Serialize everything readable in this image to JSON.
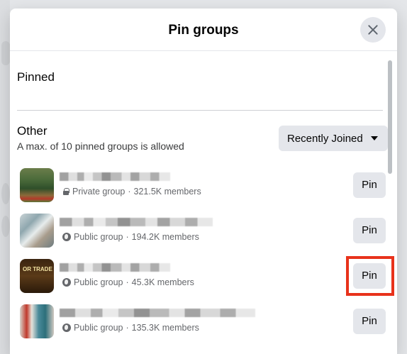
{
  "dialog": {
    "title": "Pin groups",
    "close_icon": "close-icon"
  },
  "sections": {
    "pinned_label": "Pinned",
    "other_label": "Other",
    "other_hint": "A max. of 10 pinned groups is allowed"
  },
  "sort": {
    "selected": "Recently Joined",
    "icon": "caret-down-icon"
  },
  "groups": [
    {
      "privacy": "Private group",
      "members": "321.5K members",
      "privacy_icon": "lock-icon",
      "pin_label": "Pin",
      "highlighted": false
    },
    {
      "privacy": "Public group",
      "members": "194.2K members",
      "privacy_icon": "globe-icon",
      "pin_label": "Pin",
      "highlighted": false
    },
    {
      "privacy": "Public group",
      "members": "45.3K members",
      "privacy_icon": "globe-icon",
      "pin_label": "Pin",
      "highlighted": true,
      "thumb_text": "OR TRADE"
    },
    {
      "privacy": "Public group",
      "members": "135.3K members",
      "privacy_icon": "globe-icon",
      "pin_label": "Pin",
      "highlighted": false
    }
  ],
  "colors": {
    "highlight": "#e8321b",
    "button_bg": "#e4e6eb",
    "meta_text": "#65676b"
  }
}
